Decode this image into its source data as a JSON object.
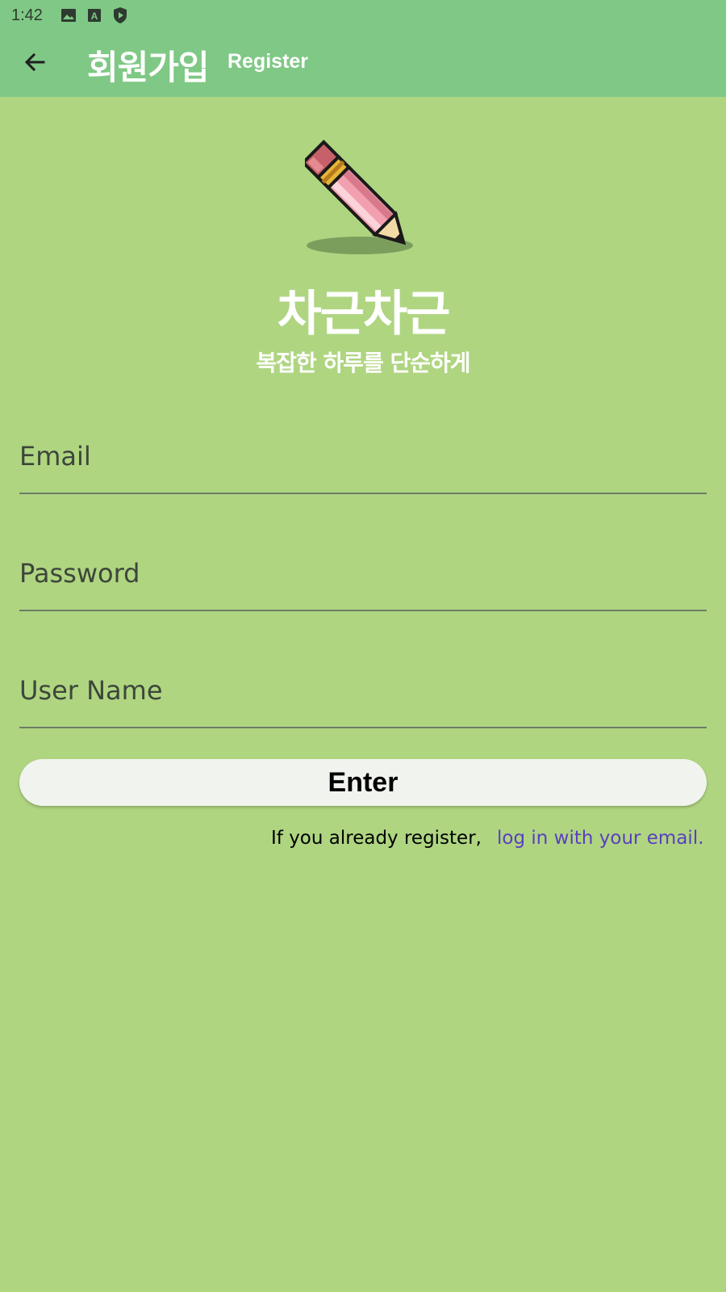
{
  "status_bar": {
    "time": "1:42",
    "icons": [
      "image-icon",
      "font-icon",
      "shield-play-icon"
    ]
  },
  "app_bar": {
    "back_icon": "arrow-back-icon",
    "title": "회원가입",
    "subtitle": "Register"
  },
  "brand": {
    "logo_icon": "pencil-icon",
    "title": "차근차근",
    "slogan": "복잡한 하루를 단순하게"
  },
  "form": {
    "email_placeholder": "Email",
    "password_placeholder": "Password",
    "username_placeholder": "User Name",
    "enter_label": "Enter"
  },
  "footer": {
    "hint": "If you already register,",
    "login_link": "log in with your email."
  },
  "colors": {
    "background": "#afd581",
    "app_bar": "#7fc885",
    "link": "#5a3fbf",
    "button": "#f1f4ee"
  }
}
